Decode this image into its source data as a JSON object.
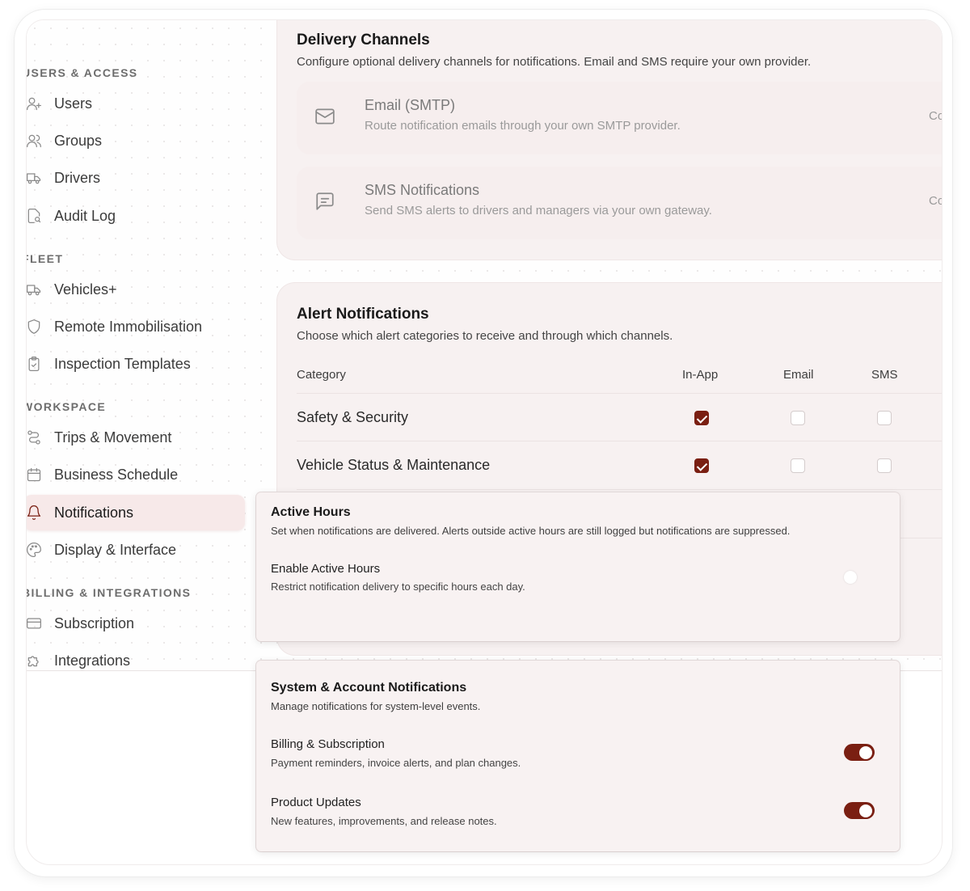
{
  "sidebar": {
    "sections": [
      {
        "title": "USERS & ACCESS",
        "items": [
          {
            "label": "Users",
            "icon": "user-plus-icon"
          },
          {
            "label": "Groups",
            "icon": "users-icon"
          },
          {
            "label": "Drivers",
            "icon": "truck-icon"
          },
          {
            "label": "Audit Log",
            "icon": "file-search-icon"
          }
        ]
      },
      {
        "title": "FLEET",
        "items": [
          {
            "label": "Vehicles+",
            "icon": "truck-icon"
          },
          {
            "label": "Remote Immobilisation",
            "icon": "shield-icon"
          },
          {
            "label": "Inspection Templates",
            "icon": "clipboard-check-icon"
          }
        ]
      },
      {
        "title": "WORKSPACE",
        "items": [
          {
            "label": "Trips & Movement",
            "icon": "route-icon"
          },
          {
            "label": "Business Schedule",
            "icon": "calendar-icon"
          },
          {
            "label": "Notifications",
            "icon": "bell-icon",
            "active": true
          },
          {
            "label": "Display & Interface",
            "icon": "palette-icon"
          }
        ]
      },
      {
        "title": "BILLING & INTEGRATIONS",
        "items": [
          {
            "label": "Subscription",
            "icon": "credit-card-icon"
          },
          {
            "label": "Integrations",
            "icon": "puzzle-icon"
          }
        ]
      }
    ]
  },
  "delivery": {
    "title": "Delivery Channels",
    "description": "Configure optional delivery channels for notifications. Email and SMS require your own provider.",
    "channels": [
      {
        "name": "Email (SMTP)",
        "description": "Route notification emails through your own SMTP provider.",
        "badge": "Coming soon",
        "icon": "mail-icon"
      },
      {
        "name": "SMS Notifications",
        "description": "Send SMS alerts to drivers and managers via your own gateway.",
        "badge": "Coming soon",
        "icon": "message-square-icon"
      }
    ]
  },
  "alerts": {
    "title": "Alert Notifications",
    "description": "Choose which alert categories to receive and through which channels.",
    "columns": [
      "Category",
      "In-App",
      "Email",
      "SMS"
    ],
    "rows": [
      {
        "label": "Safety & Security",
        "in_app": true,
        "email": false,
        "sms": false
      },
      {
        "label": "Vehicle Status & Maintenance",
        "in_app": true,
        "email": false,
        "sms": false
      }
    ]
  },
  "active_hours": {
    "title": "Active Hours",
    "description": "Set when notifications are delivered. Alerts outside active hours are still logged but notifications are suppressed.",
    "enable_label": "Enable Active Hours",
    "enable_description": "Restrict notification delivery to specific hours each day.",
    "enabled": false
  },
  "system": {
    "title": "System & Account Notifications",
    "description": "Manage notifications for system-level events.",
    "items": [
      {
        "label": "Billing & Subscription",
        "description": "Payment reminders, invoice alerts, and plan changes.",
        "enabled": true
      },
      {
        "label": "Product Updates",
        "description": "New features, improvements, and release notes.",
        "enabled": true
      }
    ]
  },
  "colors": {
    "accent": "#7a1f12",
    "card_bg": "#f7f1f1",
    "active_nav_bg": "#f7e9e9"
  }
}
